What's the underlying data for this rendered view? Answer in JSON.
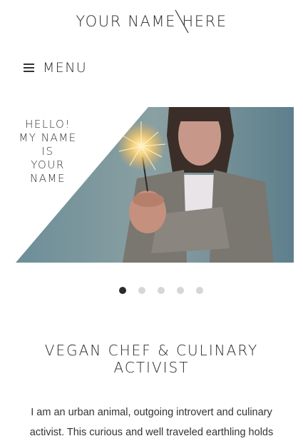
{
  "site": {
    "title": "YOUR NAME HERE"
  },
  "nav": {
    "menu_label": "MENU",
    "menu_icon": "hamburger-icon"
  },
  "hero": {
    "lines": [
      "HELLO!",
      "MY NAME",
      "IS",
      "YOUR",
      "NAME"
    ],
    "image": "woman-holding-sparkler-photo"
  },
  "carousel": {
    "count": 5,
    "active_index": 0
  },
  "section": {
    "heading_lines": [
      "VEGAN CHEF & CULINARY",
      "ACTIVIST"
    ],
    "paragraph_lines": [
      "I am an urban animal, outgoing introvert and culinary",
      "activist. This curious and well traveled earthling holds"
    ]
  },
  "colors": {
    "text": "#2a2a2a",
    "dot_active": "#2b2b2b",
    "dot_inactive": "#d6d6d6"
  }
}
